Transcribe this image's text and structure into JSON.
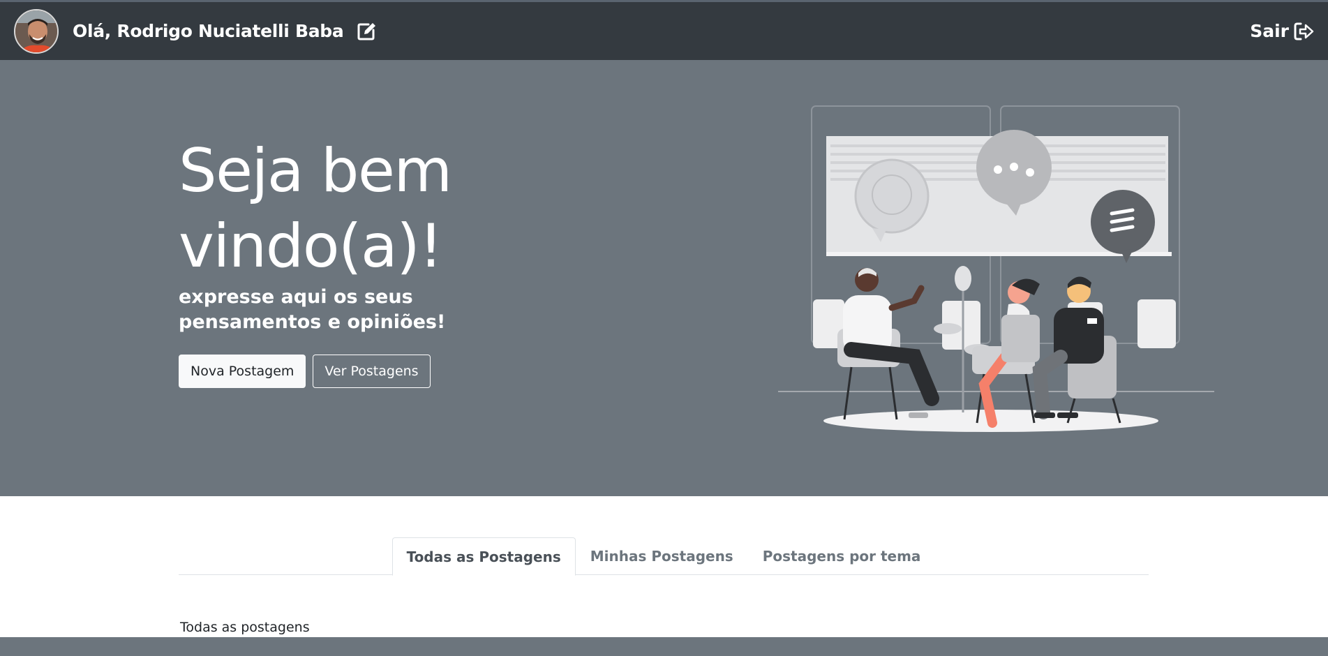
{
  "navbar": {
    "greeting": "Olá, Rodrigo Nuciatelli Baba",
    "edit_icon": "edit-icon",
    "logout_label": "Sair",
    "logout_icon": "sign-out-icon",
    "background_color": "#343a40"
  },
  "hero": {
    "title": "Seja bem vindo(a)!",
    "subtitle": "expresse aqui os seus pensamentos e opiniões!",
    "new_post_label": "Nova Postagem",
    "view_posts_label": "Ver Postagens",
    "background_color": "#6c757d"
  },
  "tabs": {
    "items": [
      {
        "label": "Todas as Postagens",
        "active": true
      },
      {
        "label": "Minhas Postagens",
        "active": false
      },
      {
        "label": "Postagens por tema",
        "active": false
      }
    ]
  },
  "content": {
    "section_label": "Todas as postagens"
  }
}
